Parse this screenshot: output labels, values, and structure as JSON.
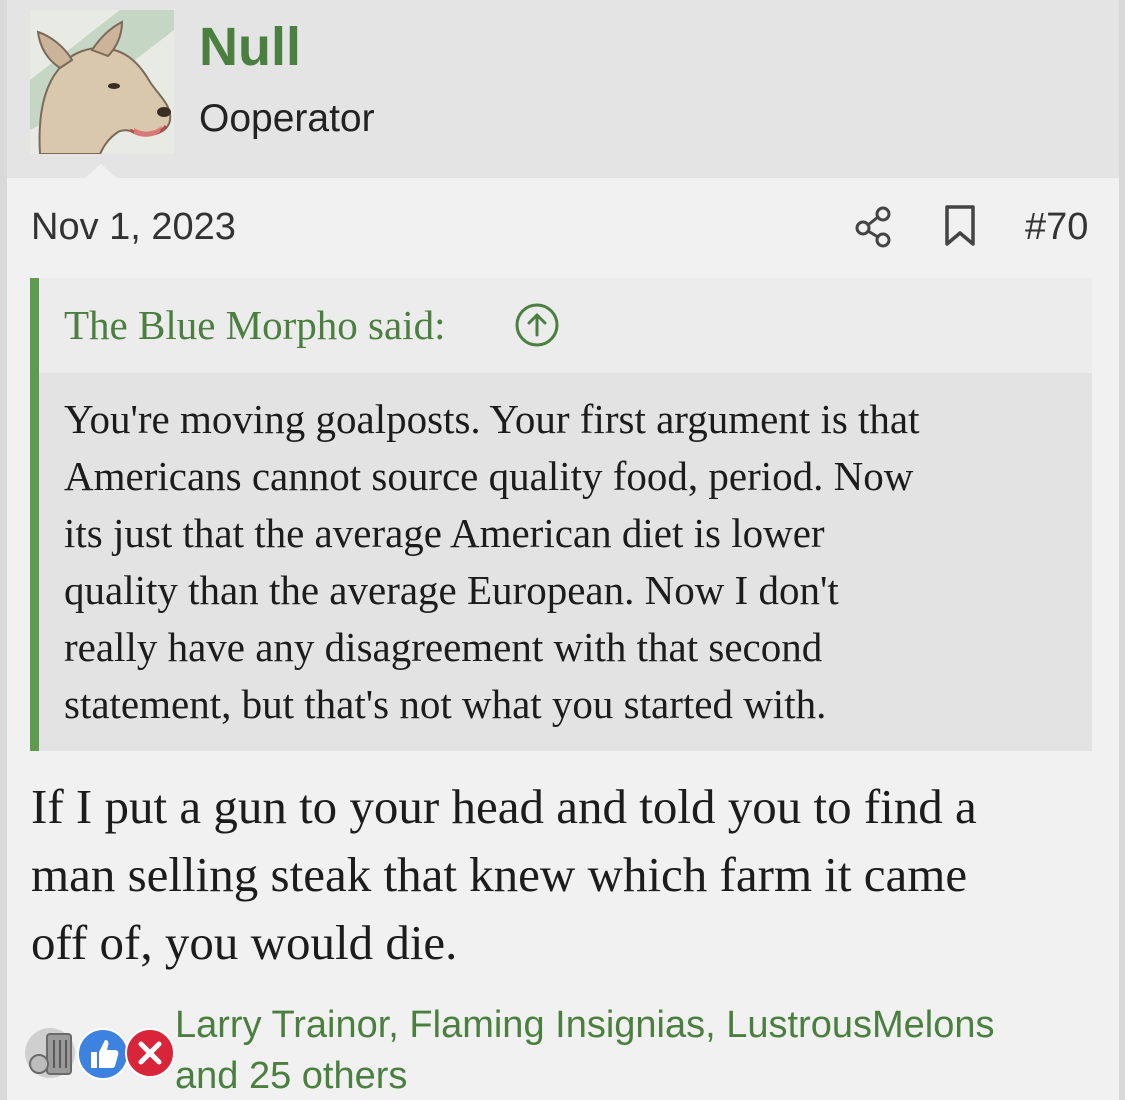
{
  "author": {
    "name": "Null",
    "title": "Ooperator",
    "avatar_icon": "dog-avatar-icon"
  },
  "post": {
    "date": "Nov 1, 2023",
    "number": "#70",
    "share_icon": "share-icon",
    "bookmark_icon": "bookmark-icon"
  },
  "quote": {
    "author_line": "The Blue Morpho said:",
    "jump_icon": "arrow-up-circle-icon",
    "lines": [
      "You're moving goalposts. Your first argument is that",
      "Americans cannot source quality food, period. Now",
      "its just that the average American diet is lower",
      "quality than the average European. Now I don't",
      "really have any disagreement with that second",
      "statement, but that's not what you started with."
    ]
  },
  "message": {
    "lines": [
      "If I put a gun to your head and told you to find a",
      "man selling steak that knew which farm it came",
      "off of, you would die."
    ]
  },
  "reactions": {
    "icons": [
      "trash-can-icon",
      "thumbs-up-icon",
      "x-mark-icon"
    ],
    "names_line1": "Larry Trainor, Flaming Insignias, LustrousMelons",
    "names_line2": "and 25 others"
  },
  "colors": {
    "accent_green": "#4a7f3f",
    "quote_bar": "#5f9b4f",
    "header_bg": "#e4e4e4",
    "post_bg": "#f1f1f1"
  }
}
